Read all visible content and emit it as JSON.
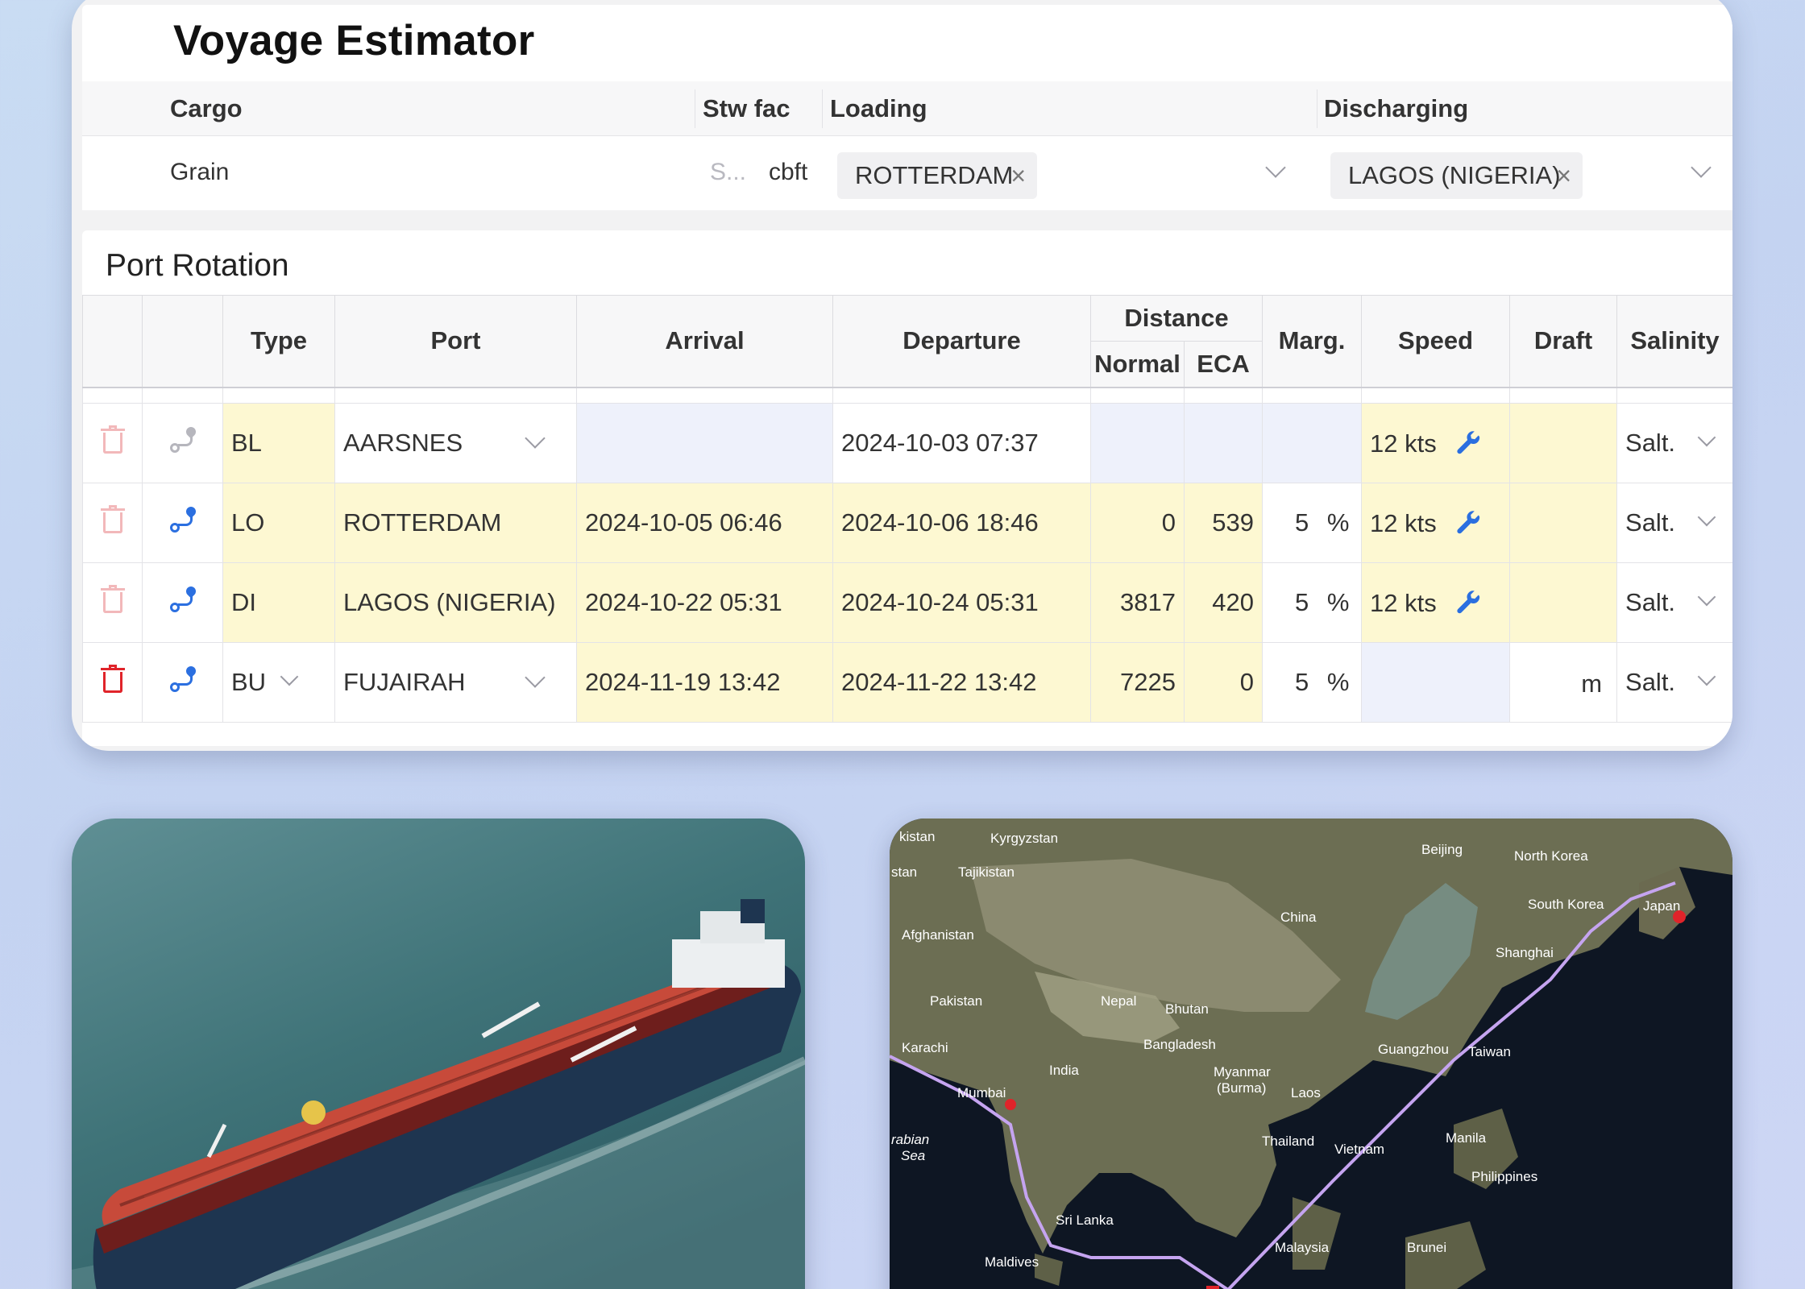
{
  "estimator": {
    "title": "Voyage Estimator",
    "headers": {
      "cargo": "Cargo",
      "stw_fac": "Stw fac",
      "loading": "Loading",
      "discharging": "Discharging"
    },
    "cargo_value": "Grain",
    "stw_placeholder": "S...",
    "stw_unit": "cbft",
    "loading_tag": "ROTTERDAM",
    "discharging_tag": "LAGOS (NIGERIA)",
    "remove_glyph": "×"
  },
  "rotation": {
    "title": "Port Rotation",
    "columns": {
      "type": "Type",
      "port": "Port",
      "arrival": "Arrival",
      "departure": "Departure",
      "distance": "Distance",
      "normal": "Normal",
      "eca": "ECA",
      "margin": "Marg.",
      "speed": "Speed",
      "draft": "Draft",
      "salinity": "Salinity"
    },
    "rows": [
      {
        "type": "BL",
        "port": "AARSNES",
        "arrival": "",
        "departure": "2024-10-03 07:37",
        "normal": "",
        "eca": "",
        "margin": "",
        "speed": "12 kts",
        "draft": "",
        "salinity": "Salt."
      },
      {
        "type": "LO",
        "port": "ROTTERDAM",
        "arrival": "2024-10-05 06:46",
        "departure": "2024-10-06 18:46",
        "normal": "0",
        "eca": "539",
        "margin": "5",
        "speed": "12 kts",
        "draft": "",
        "salinity": "Salt."
      },
      {
        "type": "DI",
        "port": "LAGOS (NIGERIA)",
        "arrival": "2024-10-22 05:31",
        "departure": "2024-10-24 05:31",
        "normal": "3817",
        "eca": "420",
        "margin": "5",
        "speed": "12 kts",
        "draft": "",
        "salinity": "Salt."
      },
      {
        "type": "BU",
        "port": "FUJAIRAH",
        "arrival": "2024-11-19 13:42",
        "departure": "2024-11-22 13:42",
        "normal": "7225",
        "eca": "0",
        "margin": "5",
        "speed": "",
        "draft": "m",
        "salinity": "Salt."
      }
    ],
    "percent": "%"
  },
  "map": {
    "labels": {
      "kazakhstan": "kistan",
      "kyrgyzstan": "Kyrgyzstan",
      "uzbek": "stan",
      "tajikistan": "Tajikistan",
      "afghanistan": "Afghanistan",
      "pakistan": "Pakistan",
      "karachi": "Karachi",
      "nepal": "Nepal",
      "bhutan": "Bhutan",
      "china": "China",
      "beijing": "Beijing",
      "north_korea": "North Korea",
      "south_korea": "South Korea",
      "japan": "Japan",
      "shanghai": "Shanghai",
      "bangladesh": "Bangladesh",
      "india": "India",
      "myanmar": "Myanmar",
      "burma": "(Burma)",
      "laos": "Laos",
      "guangzhou": "Guangzhou",
      "taiwan": "Taiwan",
      "mumbai": "Mumbai",
      "arabian": "rabian",
      "sea": "Sea",
      "thailand": "Thailand",
      "vietnam": "Vietnam",
      "manila": "Manila",
      "philippines": "Philippines",
      "sri_lanka": "Sri Lanka",
      "malaysia": "Malaysia",
      "brunei": "Brunei",
      "maldives": "Maldives"
    }
  },
  "colors": {
    "highlight_yellow": "#fdf8d2",
    "light_blue": "#eef1fb",
    "accent_blue": "#2b6fe0",
    "delete_red": "#e0242a",
    "delete_faded": "#f2b8ba",
    "route_line": "#c5a4f0"
  }
}
